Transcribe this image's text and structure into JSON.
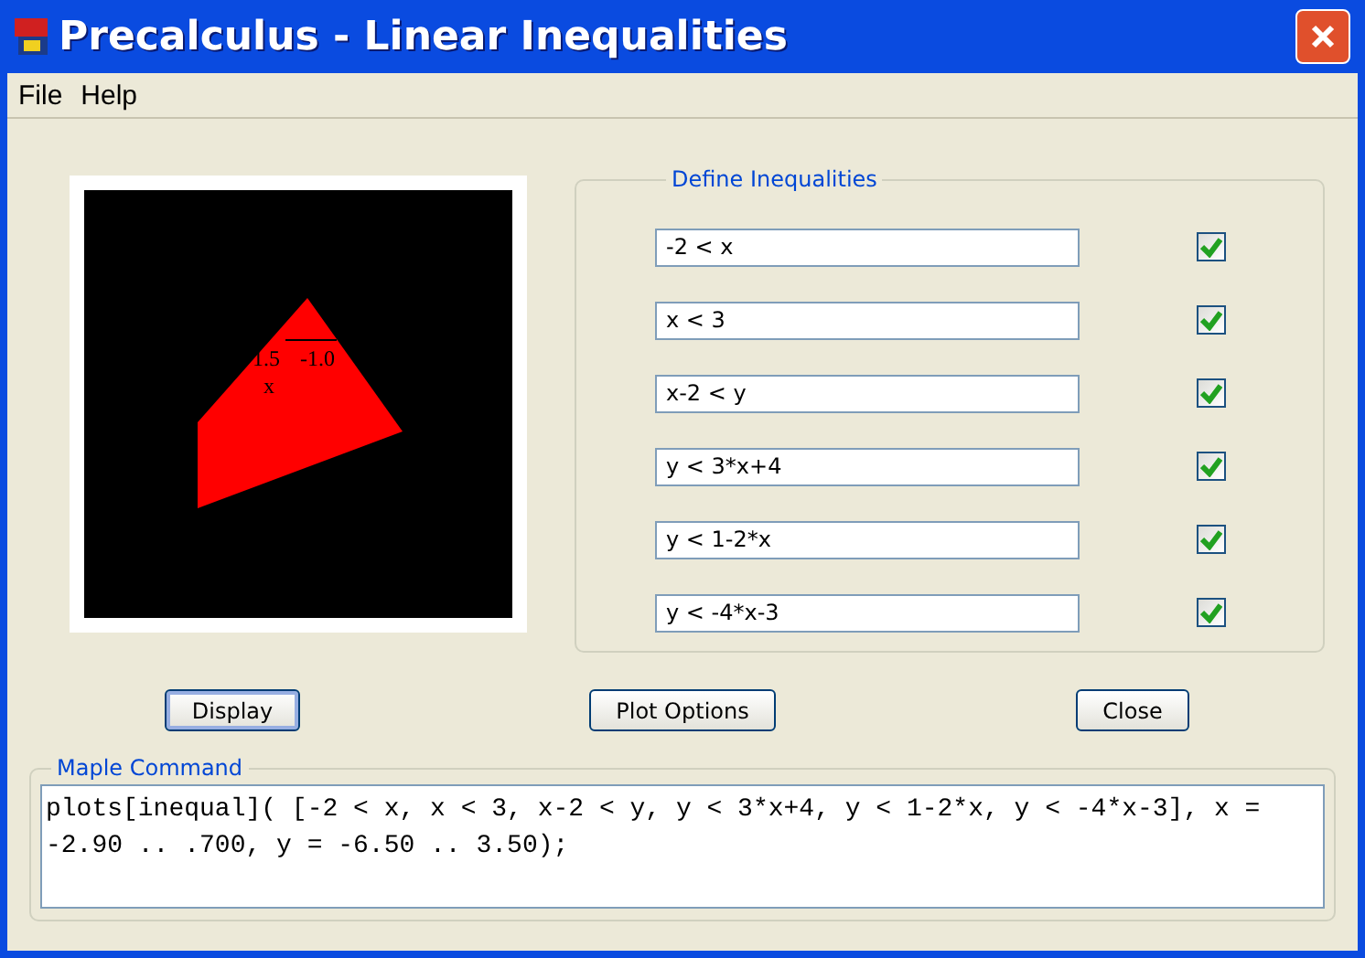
{
  "window": {
    "title": "Precalculus - Linear Inequalities"
  },
  "menu": [
    "File",
    "Help"
  ],
  "plot": {
    "tick_labels": [
      "1.5",
      "-1.0"
    ],
    "axis_label": "x"
  },
  "inequalities": {
    "title": "Define Inequalities",
    "rows": [
      {
        "value": "-2 < x",
        "checked": true
      },
      {
        "value": "x < 3",
        "checked": true
      },
      {
        "value": "x-2 < y",
        "checked": true
      },
      {
        "value": "y < 3*x+4",
        "checked": true
      },
      {
        "value": "y < 1-2*x",
        "checked": true
      },
      {
        "value": "y < -4*x-3",
        "checked": true
      }
    ]
  },
  "buttons": [
    {
      "label": "Display",
      "selected": true
    },
    {
      "label": "Plot Options",
      "selected": false
    },
    {
      "label": "Close",
      "selected": false
    }
  ],
  "maple_command": {
    "title": "Maple Command",
    "value": "plots[inequal]( [-2 < x, x < 3, x-2 < y, y < 3*x+4, y < 1-2*x, y < -4*x-3], x = -2.90 .. .700, y = -6.50 .. 3.50);"
  }
}
